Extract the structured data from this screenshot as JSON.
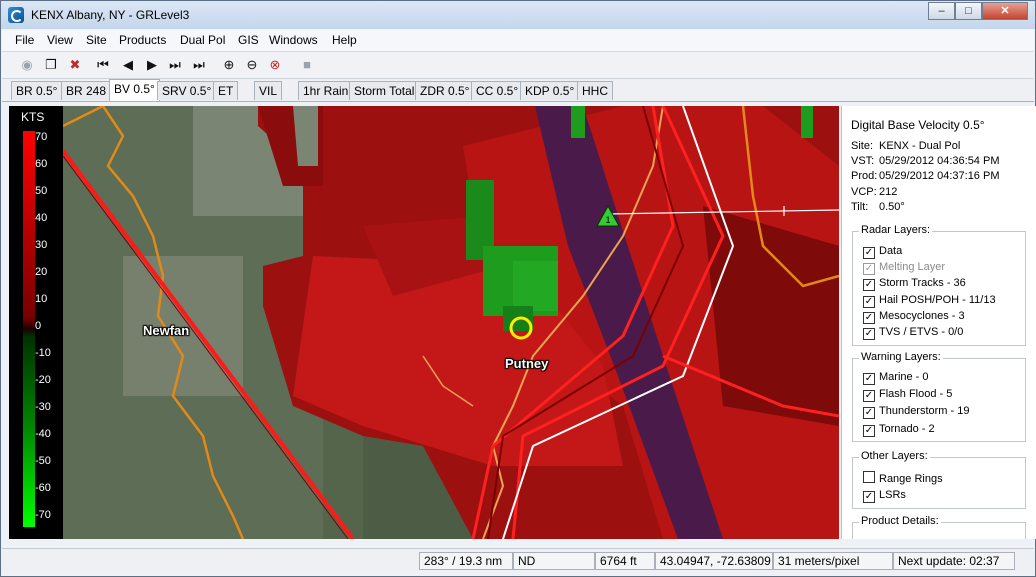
{
  "window": {
    "title": "KENX Albany, NY - GRLevel3"
  },
  "menu": [
    "File",
    "View",
    "Site",
    "Products",
    "Dual Pol",
    "GIS",
    "Windows",
    "Help"
  ],
  "toolbar": {
    "icons": [
      "new-window-icon",
      "copy-icon",
      "delete-icon",
      "first-frame-icon",
      "previous-frame-icon",
      "play-icon",
      "next-frame-icon",
      "last-frame-icon",
      "zoom-in-icon",
      "zoom-out-icon",
      "zoom-reset-icon",
      "stop-icon"
    ]
  },
  "tabs": [
    "BR 0.5°",
    "BR 248",
    "BV 0.5°",
    "SRV 0.5°",
    "ET",
    "VIL",
    "1hr Rain",
    "Storm Total",
    "ZDR 0.5°",
    "CC 0.5°",
    "KDP 0.5°",
    "HHC"
  ],
  "active_tab": "BV 0.5°",
  "legend": {
    "unit": "KTS",
    "ticks": [
      "70",
      "60",
      "50",
      "40",
      "30",
      "20",
      "10",
      "0",
      "-10",
      "-20",
      "-30",
      "-40",
      "-50",
      "-60",
      "-70"
    ]
  },
  "map": {
    "labels": {
      "town1": "Newfan",
      "town2": "Putney"
    },
    "storm_track_marker": "1"
  },
  "info": {
    "product": "Digital Base Velocity 0.5°",
    "site_label": "Site:",
    "site_value": "KENX - Dual Pol",
    "vst_label": "VST:",
    "vst_value": "05/29/2012 04:36:54 PM",
    "prod_label": "Prod:",
    "prod_value": "05/29/2012 04:37:16 PM",
    "vcp_label": "VCP:",
    "vcp_value": "212",
    "tilt_label": "Tilt:",
    "tilt_value": "0.50°"
  },
  "radar_layers": {
    "title": "Radar Layers:",
    "items": [
      {
        "label": "Data",
        "checked": true,
        "enabled": true
      },
      {
        "label": "Melting Layer",
        "checked": true,
        "enabled": false
      },
      {
        "label": "Storm Tracks - 36",
        "checked": true,
        "enabled": true
      },
      {
        "label": "Hail POSH/POH - 11/13",
        "checked": true,
        "enabled": true
      },
      {
        "label": "Mesocyclones - 3",
        "checked": true,
        "enabled": true
      },
      {
        "label": "TVS / ETVS - 0/0",
        "checked": true,
        "enabled": true
      }
    ]
  },
  "warning_layers": {
    "title": "Warning Layers:",
    "items": [
      {
        "label": "Marine - 0",
        "checked": true
      },
      {
        "label": "Flash Flood - 5",
        "checked": true
      },
      {
        "label": "Thunderstorm - 19",
        "checked": true
      },
      {
        "label": "Tornado - 2",
        "checked": true
      }
    ]
  },
  "other_layers": {
    "title": "Other Layers:",
    "items": [
      {
        "label": "Range Rings",
        "checked": false
      },
      {
        "label": "LSRs",
        "checked": true
      }
    ]
  },
  "product_details": {
    "title": "Product Details:"
  },
  "status": {
    "azimuth_range": "283° / 19.3 nm",
    "value": "ND",
    "height": "6764 ft",
    "coords": "43.04947, -72.63809",
    "resolution": "31 meters/pixel",
    "next_update": "Next update: 02:37"
  }
}
